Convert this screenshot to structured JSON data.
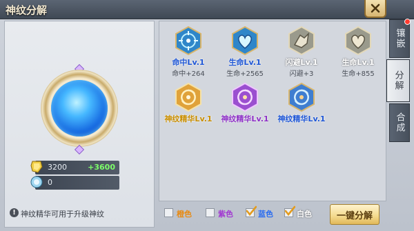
{
  "window": {
    "title": "神纹分解"
  },
  "left": {
    "resources": [
      {
        "icon": "rune-essence-icon",
        "value": "3200",
        "gain": "+3600"
      },
      {
        "icon": "rune-shard-icon",
        "value": "0",
        "gain": ""
      }
    ],
    "tip": "神纹精华可用于升级神纹"
  },
  "runes": [
    {
      "name": "命中Lv.1",
      "stat": "命中+264",
      "name_color": "#1f57d6",
      "icon": "rune-hit-icon",
      "tone": "blue"
    },
    {
      "name": "生命Lv.1",
      "stat": "生命+2565",
      "name_color": "#1f57d6",
      "icon": "rune-life-icon",
      "tone": "blue"
    },
    {
      "name": "闪避Lv.1",
      "stat": "闪避+3",
      "name_color": "#ffffff",
      "icon": "rune-dodge-icon",
      "tone": "gray"
    },
    {
      "name": "生命Lv.1",
      "stat": "生命+855",
      "name_color": "#ffffff",
      "icon": "rune-life-icon",
      "tone": "gray"
    },
    {
      "name": "神纹精华Lv.1",
      "stat": "",
      "name_color": "#c98e00",
      "icon": "rune-essence-gold-icon",
      "tone": "gold"
    },
    {
      "name": "神纹精华Lv.1",
      "stat": "",
      "name_color": "#8d2fc6",
      "icon": "rune-essence-purple-icon",
      "tone": "purple"
    },
    {
      "name": "神纹精华Lv.1",
      "stat": "",
      "name_color": "#1f57d6",
      "icon": "rune-essence-blue-icon",
      "tone": "blue"
    }
  ],
  "tabs": [
    {
      "label": "镶嵌",
      "active": false,
      "badge": true
    },
    {
      "label": "分解",
      "active": true,
      "badge": false
    },
    {
      "label": "合成",
      "active": false,
      "badge": false
    }
  ],
  "filters": [
    {
      "label": "橙色",
      "color": "#e88a12",
      "checked": false
    },
    {
      "label": "紫色",
      "color": "#a23ad1",
      "checked": false
    },
    {
      "label": "蓝色",
      "color": "#2a6cf0",
      "checked": true
    },
    {
      "label": "白色",
      "color": "#ffffff",
      "checked": true
    }
  ],
  "actions": {
    "decompose_all": "一键分解"
  }
}
